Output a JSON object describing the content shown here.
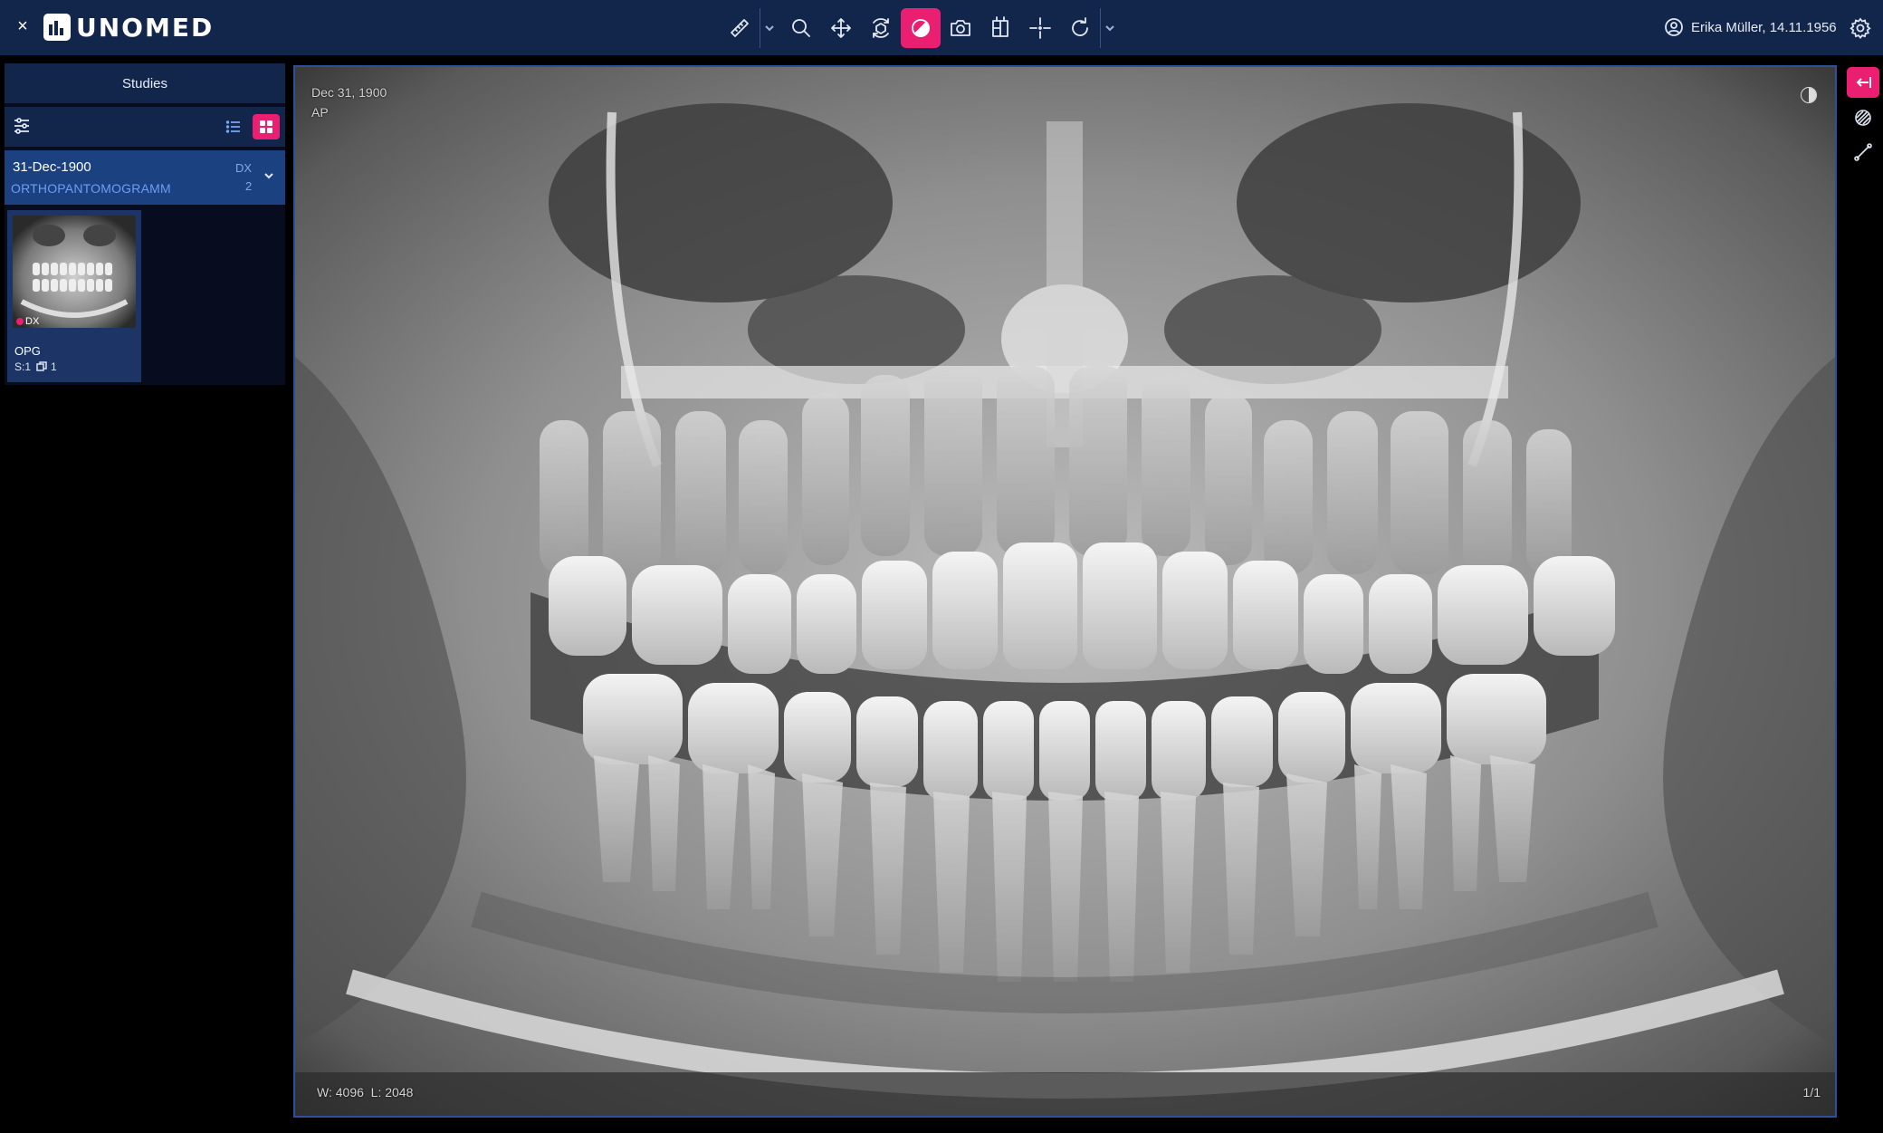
{
  "app": {
    "close_label": "×",
    "logo_text": "UNOMED"
  },
  "toolbar": {
    "tools": [
      {
        "name": "ruler-icon",
        "active": false,
        "has_caret": true
      },
      {
        "name": "zoom-icon",
        "active": false,
        "has_caret": false
      },
      {
        "name": "pan-icon",
        "active": false,
        "has_caret": false
      },
      {
        "name": "rotate-3d-icon",
        "active": false,
        "has_caret": false
      },
      {
        "name": "window-level-icon",
        "active": true,
        "has_caret": false
      },
      {
        "name": "camera-icon",
        "active": false,
        "has_caret": false
      },
      {
        "name": "layout-grid-icon",
        "active": false,
        "has_caret": false
      },
      {
        "name": "crosshair-icon",
        "active": false,
        "has_caret": false
      },
      {
        "name": "reset-icon",
        "active": false,
        "has_caret": true
      }
    ]
  },
  "header": {
    "patient": "Erika Müller, 14.11.1956"
  },
  "sidebar": {
    "title": "Studies",
    "study": {
      "date": "31-Dec-1900",
      "description": "ORTHOPANTOMOGRAMM",
      "modality": "DX",
      "count": "2"
    },
    "series": {
      "modality": "DX",
      "name": "OPG",
      "series_number": "S:1",
      "instances": "1"
    }
  },
  "viewport": {
    "date": "Dec 31, 1900",
    "view": "AP",
    "window_level": "W: 4096  L: 2048",
    "frame": "1/1"
  },
  "colors": {
    "topbar": "#12254b",
    "accent": "#ea1f72",
    "study_card": "#1c4180",
    "link_blue": "#6e9df1",
    "viewport_border": "#2e4f9c"
  }
}
